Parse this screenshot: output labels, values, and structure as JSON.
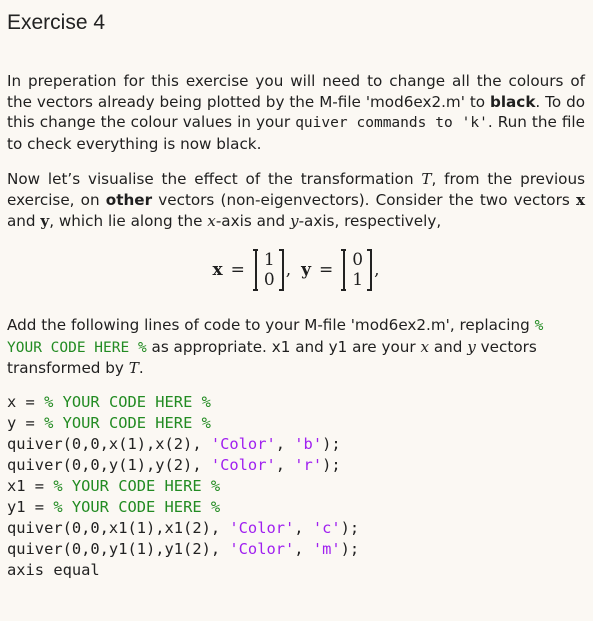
{
  "title": "Exercise 4",
  "para1": {
    "t1": "In preperation for this exercise you will need to change all the colours of the vectors already being plotted by the M-file 'mod6ex2.m' to ",
    "bold": "black",
    "t2": ". To do this change the colour values in your ",
    "mono": "quiver commands to 'k'",
    "t3": ". Run the file to check everything is now black."
  },
  "para2": {
    "t1": "Now let’s visualise the effect of the transformation ",
    "T": "T",
    "t2": ", from the previous exercise, on ",
    "bold": "other",
    "t3": " vectors (non-eigenvectors). Consider the two vectors ",
    "x": "x",
    "t4": " and ",
    "y": "y",
    "t5": ", which lie along the ",
    "xaxis": "x",
    "t6": "-axis and ",
    "yaxis": "y",
    "t7": "-axis, respectively,"
  },
  "equation": {
    "x_label": "x",
    "x_vec": [
      "1",
      "0"
    ],
    "y_label": "y",
    "y_vec": [
      "0",
      "1"
    ],
    "eq": "=",
    "comma": ","
  },
  "para3": {
    "t1": "Add the following lines of code to your M-file 'mod6ex2.m', replacing ",
    "placeholder": "% YOUR CODE HERE %",
    "t2": " as appropriate. x1 and y1 are your ",
    "x": "x",
    "t3": " and ",
    "y": "y",
    "t4": " vectors transformed by ",
    "T": "T",
    "t5": "."
  },
  "code": [
    {
      "plain": "x = ",
      "comment": "% YOUR CODE HERE %"
    },
    {
      "plain": "y = ",
      "comment": "% YOUR CODE HERE %"
    },
    {
      "plain": "quiver(0,0,x(1),x(2), ",
      "str1": "'Color'",
      "mid": ", ",
      "str2": "'b'",
      "end": ");"
    },
    {
      "plain": "quiver(0,0,y(1),y(2), ",
      "str1": "'Color'",
      "mid": ", ",
      "str2": "'r'",
      "end": ");"
    },
    {
      "plain": "x1 = ",
      "comment": "% YOUR CODE HERE %"
    },
    {
      "plain": "y1 = ",
      "comment": "% YOUR CODE HERE %"
    },
    {
      "plain": "quiver(0,0,x1(1),x1(2), ",
      "str1": "'Color'",
      "mid": ", ",
      "str2": "'c'",
      "end": ");"
    },
    {
      "plain": "quiver(0,0,y1(1),y1(2), ",
      "str1": "'Color'",
      "mid": ", ",
      "str2": "'m'",
      "end": ");"
    },
    {
      "plain": "axis equal"
    }
  ],
  "colors": {
    "background": "#fbf8f3",
    "text": "#1f1f1f",
    "comment": "#228b22",
    "string": "#a020f0"
  }
}
